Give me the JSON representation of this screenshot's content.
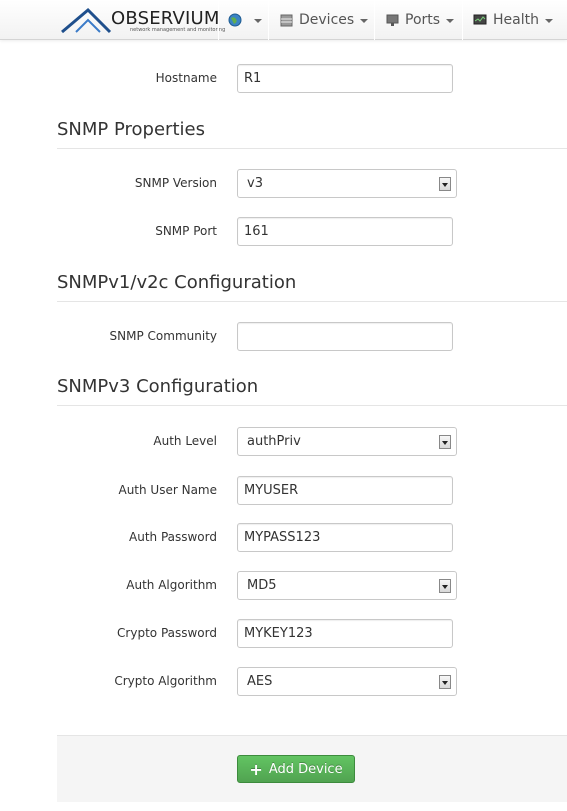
{
  "navbar": {
    "brand_name": "OBSERVIUM",
    "brand_tagline": "network management and monitoring",
    "items": [
      {
        "label": "",
        "icon": "globe-icon"
      },
      {
        "label": "Devices",
        "icon": "server-icon"
      },
      {
        "label": "Ports",
        "icon": "network-port-icon"
      },
      {
        "label": "Health",
        "icon": "monitor-icon"
      }
    ]
  },
  "form": {
    "hostname": {
      "label": "Hostname",
      "value": "R1"
    },
    "snmp_properties": {
      "title": "SNMP Properties",
      "version": {
        "label": "SNMP Version",
        "value": "v3"
      },
      "port": {
        "label": "SNMP Port",
        "value": "161"
      }
    },
    "snmp_v1v2c": {
      "title": "SNMPv1/v2c Configuration",
      "community": {
        "label": "SNMP Community",
        "value": ""
      }
    },
    "snmp_v3": {
      "title": "SNMPv3 Configuration",
      "auth_level": {
        "label": "Auth Level",
        "value": "authPriv"
      },
      "auth_user": {
        "label": "Auth User Name",
        "value": "MYUSER"
      },
      "auth_password": {
        "label": "Auth Password",
        "value": "MYPASS123"
      },
      "auth_algorithm": {
        "label": "Auth Algorithm",
        "value": "MD5"
      },
      "crypto_password": {
        "label": "Crypto Password",
        "value": "MYKEY123"
      },
      "crypto_algorithm": {
        "label": "Crypto Algorithm",
        "value": "AES"
      }
    },
    "submit_label": "Add Device"
  },
  "colors": {
    "accent_green": "#51a351",
    "navbar_bg": "#f2f2f2"
  }
}
